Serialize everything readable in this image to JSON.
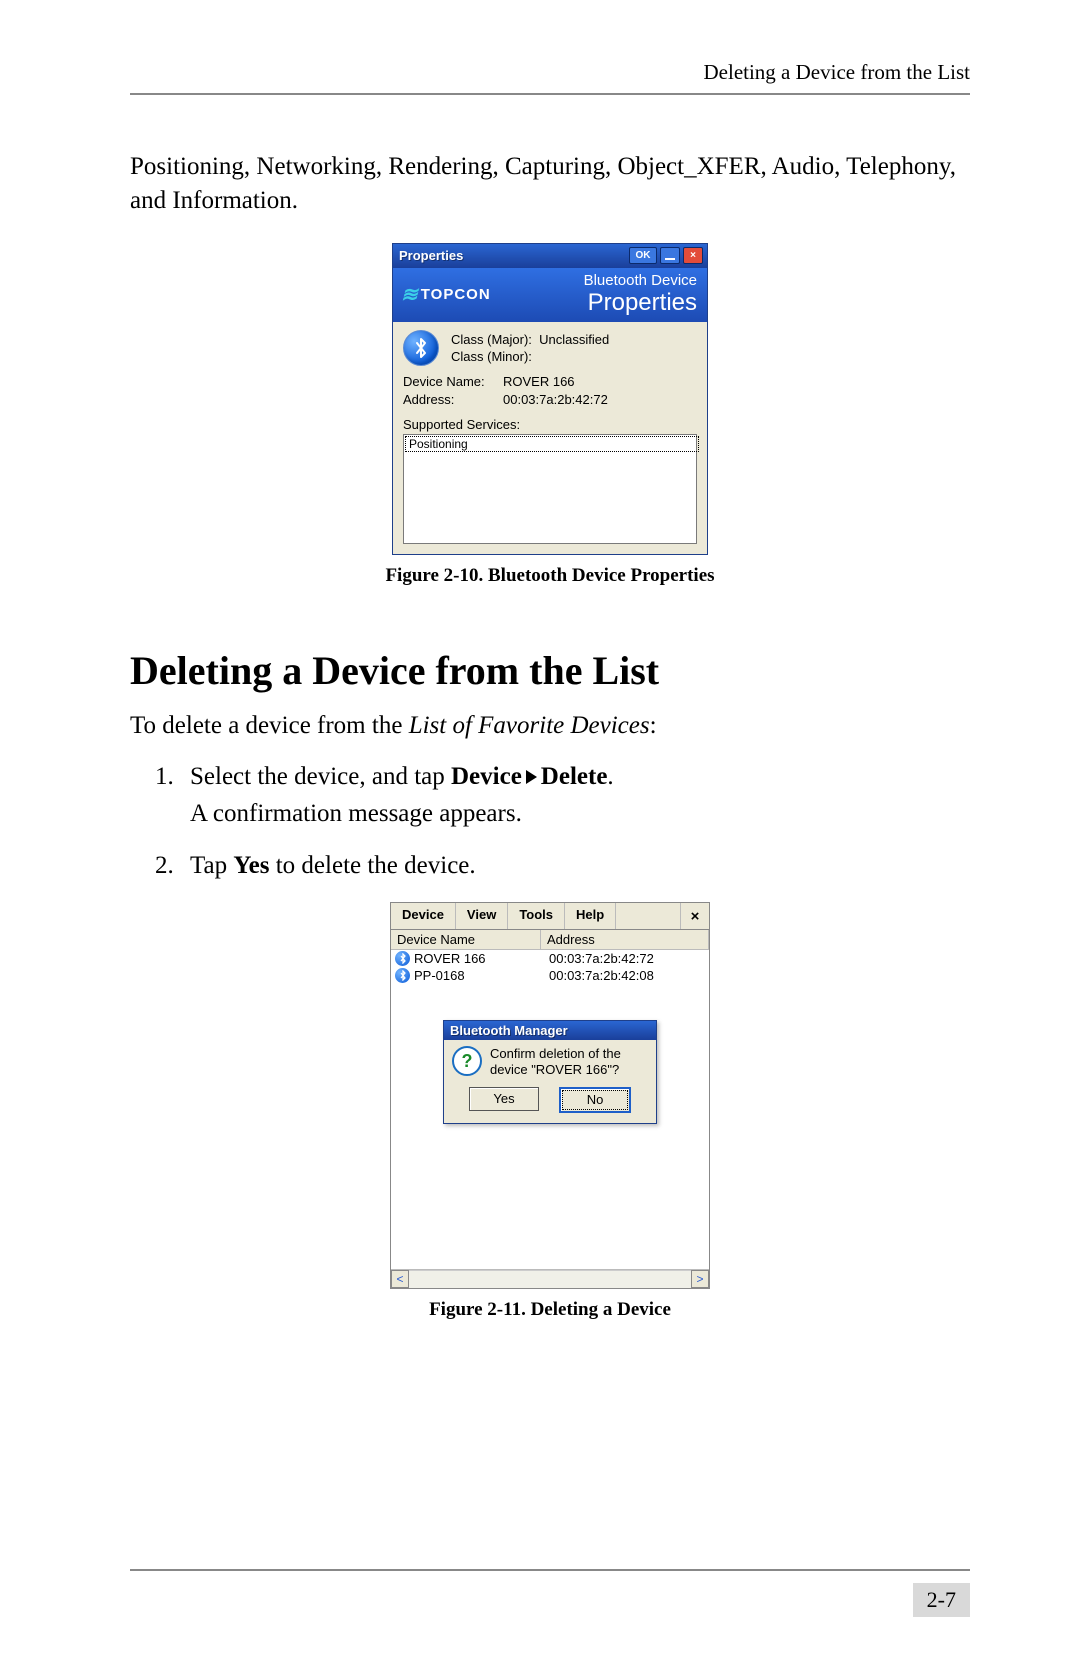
{
  "running_header": "Deleting a Device from the List",
  "intro_para": "Positioning, Networking, Rendering, Capturing, Object_XFER, Audio, Telephony, and Information.",
  "fig1": {
    "caption": "Figure 2-10. Bluetooth Device Properties",
    "titlebar": "Properties",
    "ok": "OK",
    "close_x": "×",
    "brand": "TOPCON",
    "header_line1": "Bluetooth Device",
    "header_line2": "Properties",
    "class_major_lbl": "Class (Major):",
    "class_major_val": "Unclassified",
    "class_minor_lbl": "Class (Minor):",
    "class_minor_val": "",
    "device_name_lbl": "Device Name:",
    "device_name_val": "ROVER 166",
    "address_lbl": "Address:",
    "address_val": "00:03:7a:2b:42:72",
    "supported_lbl": "Supported Services:",
    "service_item": "Positioning"
  },
  "section_heading": "Deleting a Device from the List",
  "lead_pre": "To delete a device from the ",
  "lead_em": "List of Favorite Devices",
  "lead_post": ":",
  "step1_a": "Select the device, and tap ",
  "step1_b1": "Device",
  "step1_b2": "Delete",
  "step1_c": ".",
  "step1_line2": "A confirmation message appears.",
  "step2_a": "Tap ",
  "step2_b": "Yes",
  "step2_c": " to delete the device.",
  "fig2": {
    "caption": "Figure 2-11. Deleting a Device",
    "menus": [
      "Device",
      "View",
      "Tools",
      "Help"
    ],
    "close_x": "×",
    "col1": "Device Name",
    "col2": "Address",
    "rows": [
      {
        "name": "ROVER 166",
        "addr": "00:03:7a:2b:42:72"
      },
      {
        "name": "PP-0168",
        "addr": "00:03:7a:2b:42:08"
      }
    ],
    "dlg_title": "Bluetooth Manager",
    "dlg_msg": "Confirm deletion of the device \"ROVER 166\"?",
    "btn_yes": "Yes",
    "btn_no": "No",
    "scroll_left": "<",
    "scroll_right": ">"
  },
  "page_num": "2-7"
}
